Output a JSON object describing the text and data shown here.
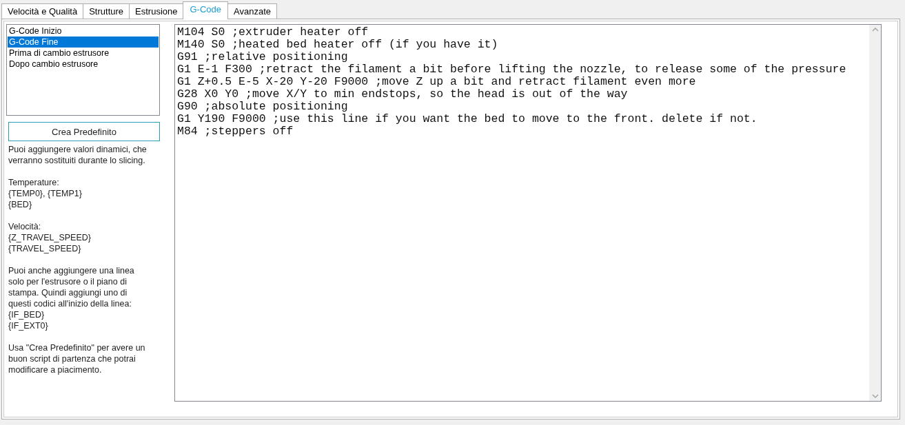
{
  "tabs": [
    {
      "label": "Velocità e Qualità",
      "selected": false
    },
    {
      "label": "Strutture",
      "selected": false
    },
    {
      "label": "Estrusione",
      "selected": false
    },
    {
      "label": "G-Code",
      "selected": true
    },
    {
      "label": "Avanzate",
      "selected": false
    }
  ],
  "script_list": [
    {
      "label": "G-Code Inizio",
      "selected": false
    },
    {
      "label": "G-Code Fine",
      "selected": true
    },
    {
      "label": "Prima di cambio estrusore",
      "selected": false
    },
    {
      "label": "Dopo cambio estrusore",
      "selected": false
    }
  ],
  "default_button": "Crea Predefinito",
  "help_paragraphs": [
    "Puoi aggiungere valori dinamici, che\nverranno sostituiti durante lo slicing.",
    "Temperature:\n{TEMP0}, {TEMP1}\n{BED}",
    "Velocità:\n{Z_TRAVEL_SPEED}\n{TRAVEL_SPEED}",
    "Puoi anche aggiungere una linea\nsolo per l'estrusore o il piano di\nstampa. Quindi aggiungi uno di\nquesti codici all'inizio della linea:\n{IF_BED}\n{IF_EXT0}",
    "Usa \"Crea Predefinito\" per avere un\nbuon script di partenza che potrai\nmodificare a piacimento."
  ],
  "code_lines": [
    "M104 S0 ;extruder heater off",
    "M140 S0 ;heated bed heater off (if you have it)",
    "G91 ;relative positioning",
    "G1 E-1 F300 ;retract the filament a bit before lifting the nozzle, to release some of the pressure",
    "G1 Z+0.5 E-5 X-20 Y-20 F9000 ;move Z up a bit and retract filament even more",
    "G28 X0 Y0 ;move X/Y to min endstops, so the head is out of the way",
    "G90 ;absolute positioning",
    "G1 Y190 F9000 ;use this line if you want the bed to move to the front. delete if not.",
    "M84 ;steppers off"
  ]
}
